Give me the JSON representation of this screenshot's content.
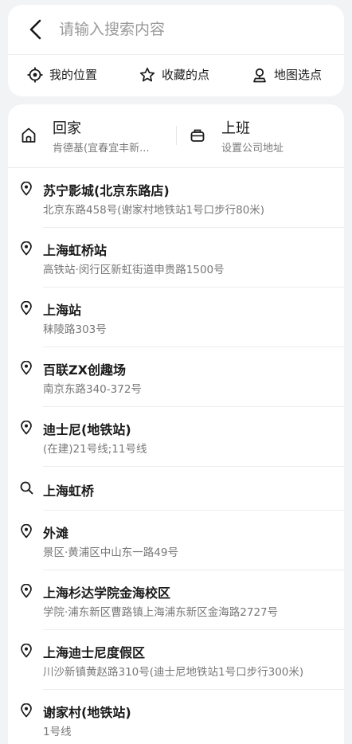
{
  "search": {
    "placeholder": "请输入搜索内容",
    "value": ""
  },
  "quick_actions": [
    {
      "label": "我的位置",
      "icon": "locate-icon"
    },
    {
      "label": "收藏的点",
      "icon": "star-icon"
    },
    {
      "label": "地图选点",
      "icon": "map-pin-person-icon"
    }
  ],
  "shortcuts": {
    "home": {
      "title": "回家",
      "subtitle": "肯德基(宜春宜丰新..."
    },
    "work": {
      "title": "上班",
      "subtitle": "设置公司地址"
    }
  },
  "results": [
    {
      "type": "place",
      "title": "苏宁影城(北京东路店)",
      "subtitle": "北京东路458号(谢家村地铁站1号口步行80米)"
    },
    {
      "type": "place",
      "title": "上海虹桥站",
      "subtitle": "高铁站·闵行区新虹街道申贵路1500号"
    },
    {
      "type": "place",
      "title": "上海站",
      "subtitle": "秣陵路303号"
    },
    {
      "type": "place",
      "title": "百联ZX创趣场",
      "subtitle": "南京东路340-372号"
    },
    {
      "type": "place",
      "title": "迪士尼(地铁站)",
      "subtitle": "(在建)21号线;11号线"
    },
    {
      "type": "query",
      "title": "上海虹桥",
      "subtitle": ""
    },
    {
      "type": "place",
      "title": "外滩",
      "subtitle": "景区·黄浦区中山东一路49号"
    },
    {
      "type": "place",
      "title": "上海杉达学院金海校区",
      "subtitle": "学院·浦东新区曹路镇上海浦东新区金海路2727号"
    },
    {
      "type": "place",
      "title": "上海迪士尼度假区",
      "subtitle": "川沙新镇黄赵路310号(迪士尼地铁站1号口步行300米)"
    },
    {
      "type": "place",
      "title": "谢家村(地铁站)",
      "subtitle": "1号线"
    }
  ]
}
